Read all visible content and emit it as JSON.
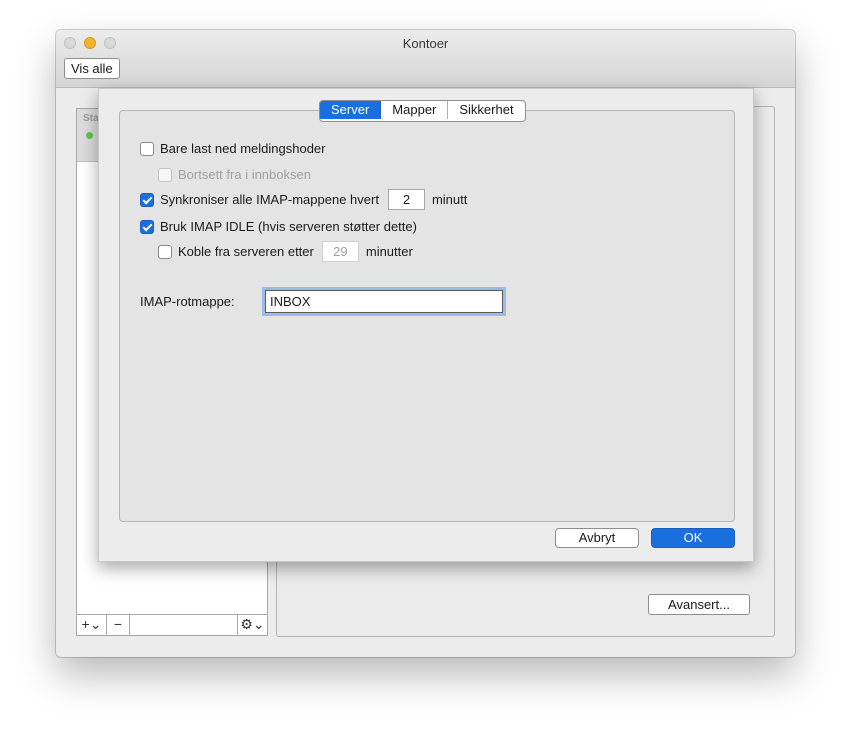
{
  "window": {
    "title": "Kontoer",
    "show_all": "Vis alle"
  },
  "account_list": {
    "header_label": "Sta",
    "add_label": "+⌄",
    "remove_label": "−",
    "gear_label": "⚙⌄"
  },
  "detail": {
    "advanced_label": "Avansert..."
  },
  "dialog": {
    "tabs": [
      {
        "label": "Server",
        "active": true
      },
      {
        "label": "Mapper",
        "active": false
      },
      {
        "label": "Sikkerhet",
        "active": false
      }
    ],
    "options": {
      "headers_only": {
        "label": "Bare last ned meldingshoder",
        "checked": false
      },
      "except_inbox": {
        "label": "Bortsett fra i innboksen",
        "checked": false,
        "disabled": true
      },
      "sync_all": {
        "label": "Synkroniser alle IMAP-mappene hvert",
        "checked": true,
        "value": "2",
        "unit": "minutt"
      },
      "idle": {
        "label": "Bruk IMAP IDLE (hvis serveren støtter dette)",
        "checked": true
      },
      "disconnect": {
        "label": "Koble fra serveren etter",
        "checked": false,
        "value": "29",
        "unit": "minutter"
      },
      "root_folder": {
        "label": "IMAP-rotmappe:",
        "value": "INBOX"
      }
    },
    "cancel_label": "Avbryt",
    "ok_label": "OK"
  }
}
